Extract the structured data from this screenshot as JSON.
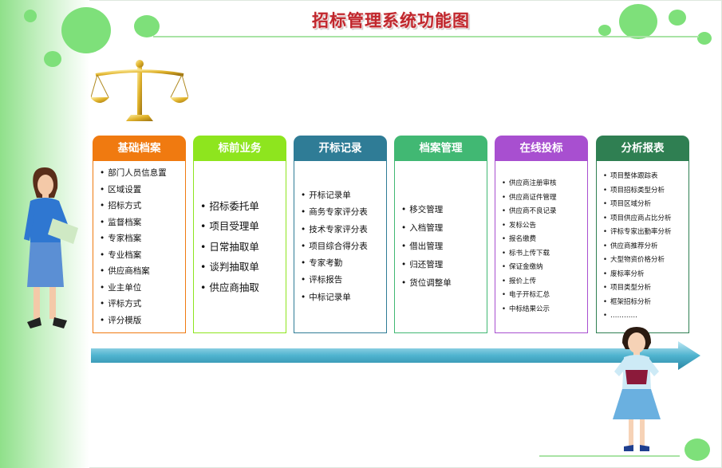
{
  "title": "招标管理系统功能图",
  "colors": {
    "orange": "#f07a10",
    "lime": "#8ee51e",
    "teal": "#2f7c96",
    "green": "#41b873",
    "purple": "#a84fd0",
    "darkgreen": "#2f7f52",
    "arrow": "#4fb3cf"
  },
  "columns": [
    {
      "header": "基础档案",
      "items": [
        "部门人员信息置",
        "区域设置",
        "招标方式",
        "监督档案",
        "专家档案",
        "专业档案",
        "供应商档案",
        "业主单位",
        "评标方式",
        "评分模版"
      ]
    },
    {
      "header": "标前业务",
      "items": [
        "招标委托单",
        "项目受理单",
        "日常抽取单",
        "谈判抽取单",
        "供应商抽取"
      ]
    },
    {
      "header": "开标记录",
      "items": [
        "开标记录单",
        "商务专家评分表",
        "技术专家评分表",
        "项目综合得分表",
        "专家考勤",
        "评标报告",
        "中标记录单"
      ]
    },
    {
      "header": "档案管理",
      "items": [
        "移交管理",
        "入档管理",
        "借出管理",
        "归还管理",
        "货位调整单"
      ]
    },
    {
      "header": "在线投标",
      "items": [
        "供应商注册审核",
        "供应商证件管理",
        "供应商不良记录",
        "发标公告",
        "报名缴费",
        "标书上传下载",
        "保证金缴纳",
        "报价上传",
        "电子开标汇总",
        "中标结果公示"
      ]
    },
    {
      "header": "分析报表",
      "items": [
        "项目整体跟踪表",
        "项目招标类型分析",
        "项目区域分析",
        "项目供应商占比分析",
        "评标专家出勤率分析",
        "供应商推荐分析",
        "大型物资价格分析",
        "废标率分析",
        "项目类型分析",
        "框架招标分析",
        "…………"
      ]
    }
  ]
}
